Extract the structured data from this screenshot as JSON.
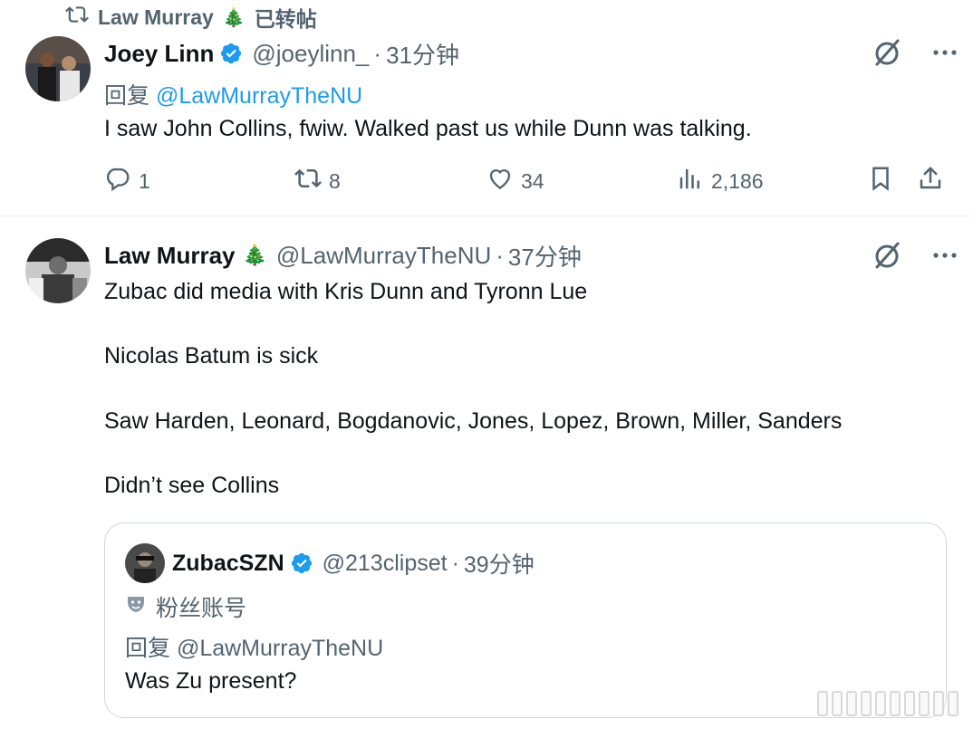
{
  "repost": {
    "user": "Law Murray",
    "emoji": "🎄",
    "label": "已转帖"
  },
  "tweet1": {
    "name": "Joey Linn",
    "handle": "@joeylinn_",
    "dot": "·",
    "time": "31分钟",
    "reply_prefix": "回复",
    "reply_mention": "@LawMurrayTheNU",
    "text": "I saw John Collins, fwiw. Walked past us while Dunn was talking.",
    "actions": {
      "replies": "1",
      "reposts": "8",
      "likes": "34",
      "views": "2,186"
    }
  },
  "tweet2": {
    "name": "Law Murray",
    "emoji": "🎄",
    "handle": "@LawMurrayTheNU",
    "dot": "·",
    "time": "37分钟",
    "lines": [
      "Zubac did media with Kris Dunn and Tyronn Lue",
      "Nicolas Batum is sick",
      "Saw Harden, Leonard, Bogdanovic, Jones, Lopez, Brown, Miller, Sanders",
      "Didn’t see Collins"
    ],
    "quote": {
      "name": "ZubacSZN",
      "handle": "@213clipset",
      "dot": "·",
      "time": "39分钟",
      "badge": "粉丝账号",
      "reply": "回复 @LawMurrayTheNU",
      "text": "Was Zu present?"
    }
  },
  "colors": {
    "text": "#0f1419",
    "secondary": "#536471",
    "link": "#1d9bf0",
    "verified": "#1d9bf0",
    "border": "#cfd9de"
  },
  "icons": [
    "repost-icon",
    "verified-icon",
    "grok-icon",
    "more-icon",
    "reply-icon",
    "retweet-icon",
    "like-icon",
    "views-icon",
    "bookmark-icon",
    "share-icon",
    "fan-mask-icon"
  ]
}
